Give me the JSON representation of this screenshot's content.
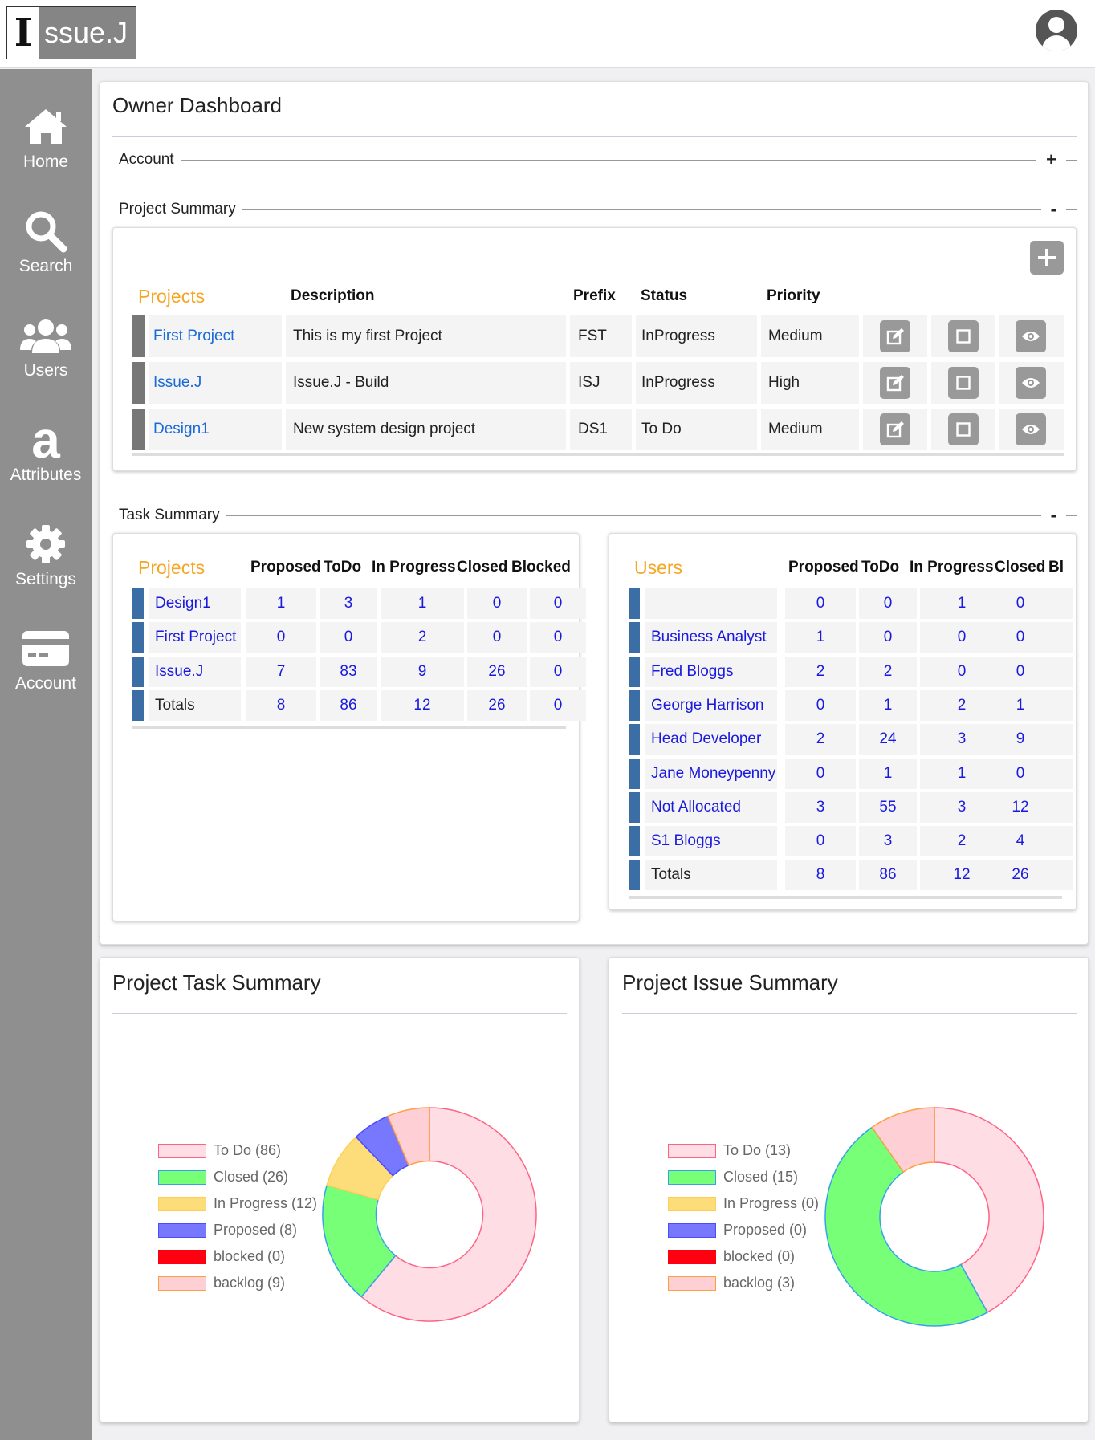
{
  "app": {
    "logo_letter": "I",
    "logo_rest": "ssue.J"
  },
  "nav": [
    {
      "label": "Home",
      "icon": "home-icon"
    },
    {
      "label": "Search",
      "icon": "search-icon"
    },
    {
      "label": "Users",
      "icon": "users-icon"
    },
    {
      "label": "Attributes",
      "icon": "attributes-icon"
    },
    {
      "label": "Settings",
      "icon": "gear-icon"
    },
    {
      "label": "Account",
      "icon": "credit-card-icon"
    }
  ],
  "dashboard": {
    "title": "Owner Dashboard"
  },
  "sections": {
    "account": {
      "label": "Account",
      "toggle": "+"
    },
    "project_summary": {
      "label": "Project Summary",
      "toggle": "-"
    },
    "task_summary": {
      "label": "Task Summary",
      "toggle": "-"
    }
  },
  "project_table": {
    "headers": {
      "projects": "Projects",
      "description": "Description",
      "prefix": "Prefix",
      "status": "Status",
      "priority": "Priority"
    },
    "rows": [
      {
        "name": "First Project",
        "description": "This is my first Project",
        "prefix": "FST",
        "status": "InProgress",
        "priority": "Medium"
      },
      {
        "name": "Issue.J",
        "description": "Issue.J - Build",
        "prefix": "ISJ",
        "status": "InProgress",
        "priority": "High"
      },
      {
        "name": "Design1",
        "description": "New system design project",
        "prefix": "DS1",
        "status": "To Do",
        "priority": "Medium"
      }
    ]
  },
  "task_projects": {
    "headers": {
      "name": "Projects",
      "proposed": "Proposed",
      "todo": "ToDo",
      "inprogress": "In Progress",
      "closed": "Closed",
      "blocked": "Blocked"
    },
    "rows": [
      {
        "name": "Design1",
        "proposed": "1",
        "todo": "3",
        "inprogress": "1",
        "closed": "0",
        "blocked": "0"
      },
      {
        "name": "First Project",
        "proposed": "0",
        "todo": "0",
        "inprogress": "2",
        "closed": "0",
        "blocked": "0"
      },
      {
        "name": "Issue.J",
        "proposed": "7",
        "todo": "83",
        "inprogress": "9",
        "closed": "26",
        "blocked": "0"
      }
    ],
    "totals": {
      "name": "Totals",
      "proposed": "8",
      "todo": "86",
      "inprogress": "12",
      "closed": "26",
      "blocked": "0"
    }
  },
  "task_users": {
    "headers": {
      "name": "Users",
      "proposed": "Proposed",
      "todo": "ToDo",
      "inprogress": "In Progress",
      "closed": "Closed",
      "blocked": "Bl"
    },
    "rows": [
      {
        "name": "",
        "proposed": "0",
        "todo": "0",
        "inprogress": "1",
        "closed": "0"
      },
      {
        "name": "Business Analyst",
        "proposed": "1",
        "todo": "0",
        "inprogress": "0",
        "closed": "0"
      },
      {
        "name": "Fred Bloggs",
        "proposed": "2",
        "todo": "2",
        "inprogress": "0",
        "closed": "0"
      },
      {
        "name": "George Harrison",
        "proposed": "0",
        "todo": "1",
        "inprogress": "2",
        "closed": "1"
      },
      {
        "name": "Head Developer",
        "proposed": "2",
        "todo": "24",
        "inprogress": "3",
        "closed": "9"
      },
      {
        "name": "Jane Moneypenny",
        "proposed": "0",
        "todo": "1",
        "inprogress": "1",
        "closed": "0"
      },
      {
        "name": "Not Allocated",
        "proposed": "3",
        "todo": "55",
        "inprogress": "3",
        "closed": "12"
      },
      {
        "name": "S1 Bloggs",
        "proposed": "0",
        "todo": "3",
        "inprogress": "2",
        "closed": "4"
      }
    ],
    "totals": {
      "name": "Totals",
      "proposed": "8",
      "todo": "86",
      "inprogress": "12",
      "closed": "26"
    }
  },
  "charts": {
    "task": {
      "title": "Project Task Summary"
    },
    "issue": {
      "title": "Project Issue Summary"
    }
  },
  "chart_data": [
    {
      "type": "pie",
      "variant": "doughnut",
      "title": "Project Task Summary",
      "legend": [
        "To Do (86)",
        "Closed (26)",
        "In Progress (12)",
        "Proposed (8)",
        "blocked (0)",
        "backlog (9)"
      ],
      "categories": [
        "To Do",
        "Closed",
        "In Progress",
        "Proposed",
        "blocked",
        "backlog"
      ],
      "values": [
        86,
        26,
        12,
        8,
        0,
        9
      ],
      "colors": [
        "#ffdde4",
        "#77ff77",
        "#fddc7a",
        "#7878ff",
        "#ff0010",
        "#ffcfd6"
      ],
      "borders": [
        "#ff6384",
        "#36a2eb",
        "#ffce56",
        "#4b4bff",
        "#ff0010",
        "#ff9f40"
      ],
      "legend_position": "left"
    },
    {
      "type": "pie",
      "variant": "doughnut",
      "title": "Project Issue Summary",
      "legend": [
        "To Do (13)",
        "Closed (15)",
        "In Progress (0)",
        "Proposed (0)",
        "blocked (0)",
        "backlog (3)"
      ],
      "categories": [
        "To Do",
        "Closed",
        "In Progress",
        "Proposed",
        "blocked",
        "backlog"
      ],
      "values": [
        13,
        15,
        0,
        0,
        0,
        3
      ],
      "colors": [
        "#ffdde4",
        "#77ff77",
        "#fddc7a",
        "#7878ff",
        "#ff0010",
        "#ffcfd6"
      ],
      "borders": [
        "#ff6384",
        "#36a2eb",
        "#ffce56",
        "#4b4bff",
        "#ff0010",
        "#ff9f40"
      ],
      "legend_position": "left"
    }
  ]
}
